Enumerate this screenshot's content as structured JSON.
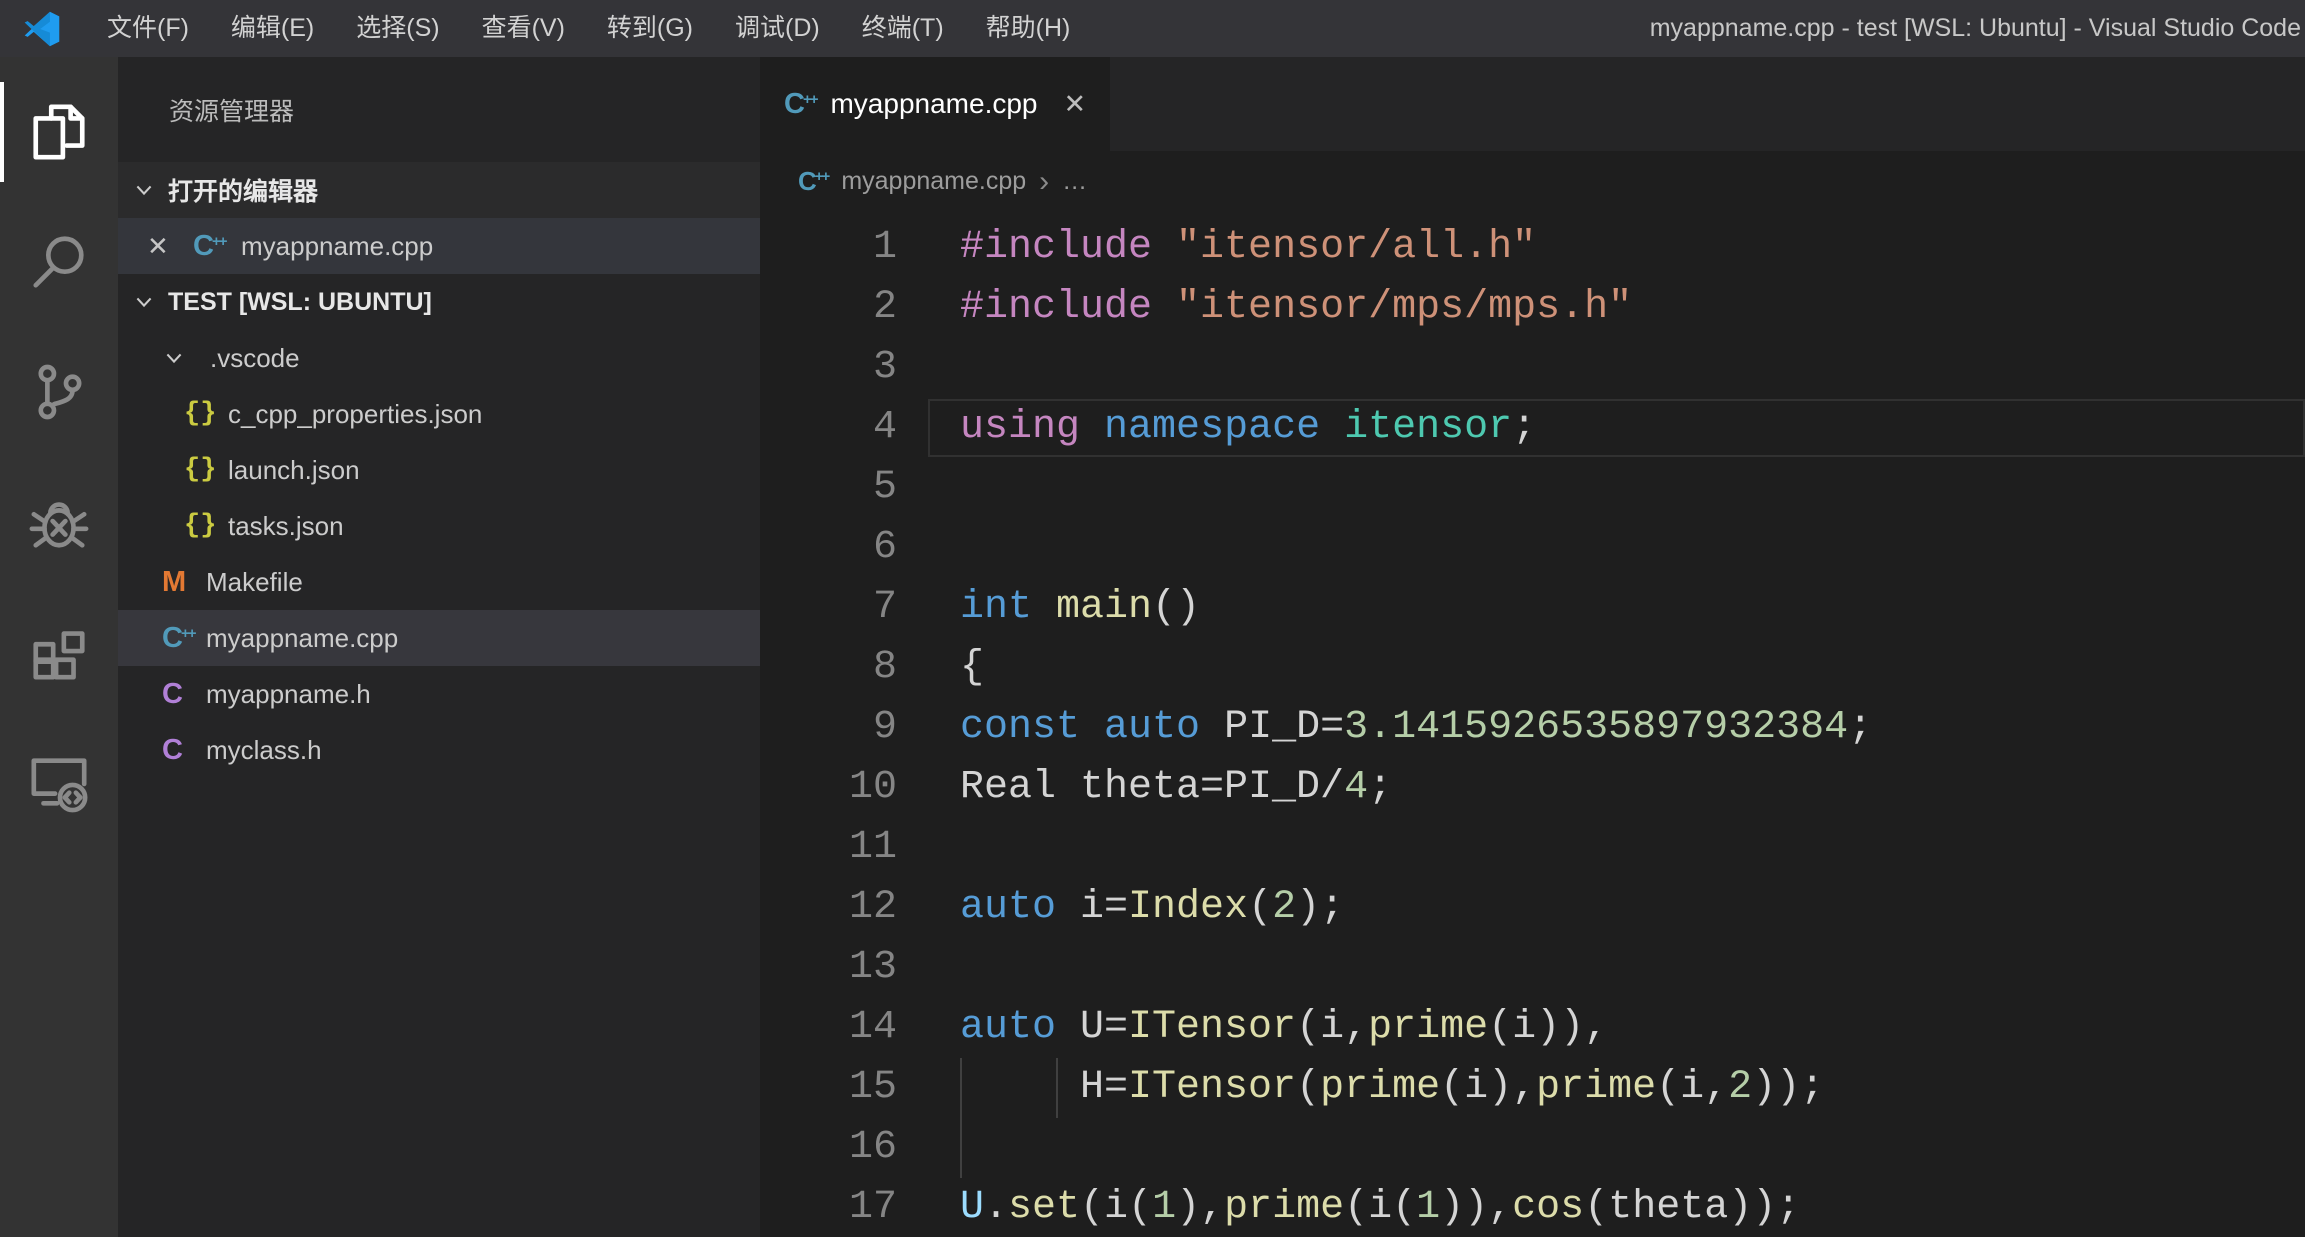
{
  "title_bar": {
    "menus": [
      "文件(F)",
      "编辑(E)",
      "选择(S)",
      "查看(V)",
      "转到(G)",
      "调试(D)",
      "终端(T)",
      "帮助(H)"
    ],
    "title": "myappname.cpp - test [WSL: Ubuntu] - Visual Studio Code"
  },
  "activity_bar": {
    "items": [
      {
        "name": "explorer",
        "active": true
      },
      {
        "name": "search",
        "active": false
      },
      {
        "name": "source-control",
        "active": false
      },
      {
        "name": "debug",
        "active": false
      },
      {
        "name": "extensions",
        "active": false
      },
      {
        "name": "remote-explorer",
        "active": false
      }
    ]
  },
  "sidebar": {
    "header": "资源管理器",
    "open_editors": {
      "label": "打开的编辑器",
      "items": [
        {
          "label": "myappname.cpp",
          "icon": "cpp"
        }
      ]
    },
    "workspace": {
      "label": "TEST [WSL: UBUNTU]",
      "tree": [
        {
          "label": ".vscode",
          "type": "folder",
          "level": 1,
          "expanded": true,
          "selected": false
        },
        {
          "label": "c_cpp_properties.json",
          "type": "json",
          "level": 2,
          "selected": false
        },
        {
          "label": "launch.json",
          "type": "json",
          "level": 2,
          "selected": false
        },
        {
          "label": "tasks.json",
          "type": "json",
          "level": 2,
          "selected": false
        },
        {
          "label": "Makefile",
          "type": "makefile",
          "level": 1,
          "selected": false
        },
        {
          "label": "myappname.cpp",
          "type": "cpp",
          "level": 1,
          "selected": true
        },
        {
          "label": "myappname.h",
          "type": "header",
          "level": 1,
          "selected": false
        },
        {
          "label": "myclass.h",
          "type": "header",
          "level": 1,
          "selected": false
        }
      ]
    }
  },
  "glyphs": {
    "close": "✕",
    "breadcrumb_sep": "›",
    "more": "…"
  },
  "editor": {
    "tab": {
      "label": "myappname.cpp",
      "icon": "cpp"
    },
    "breadcrumb": {
      "file": "myappname.cpp"
    },
    "colors": {
      "pp": "#C586C0",
      "str": "#CE9178",
      "kw": "#569CD6",
      "type": "#4EC9B0",
      "fn": "#DCDCAA",
      "num": "#B5CEA8",
      "var": "#9CDCFE",
      "def": "#D4D4D4"
    },
    "code": {
      "current_line": 4,
      "lines": [
        {
          "n": 1,
          "t": [
            [
              "pp",
              "#include"
            ],
            [
              "def",
              " "
            ],
            [
              "str",
              "\"itensor/all.h\""
            ]
          ]
        },
        {
          "n": 2,
          "t": [
            [
              "pp",
              "#include"
            ],
            [
              "def",
              " "
            ],
            [
              "str",
              "\"itensor/mps/mps.h\""
            ]
          ]
        },
        {
          "n": 3,
          "t": []
        },
        {
          "n": 4,
          "t": [
            [
              "pp",
              "using"
            ],
            [
              "def",
              " "
            ],
            [
              "kw",
              "namespace"
            ],
            [
              "def",
              " "
            ],
            [
              "type",
              "itensor"
            ],
            [
              "def",
              ";"
            ]
          ]
        },
        {
          "n": 5,
          "t": []
        },
        {
          "n": 6,
          "t": []
        },
        {
          "n": 7,
          "t": [
            [
              "kw",
              "int"
            ],
            [
              "def",
              " "
            ],
            [
              "fn",
              "main"
            ],
            [
              "def",
              "()"
            ]
          ]
        },
        {
          "n": 8,
          "t": [
            [
              "def",
              "{"
            ]
          ]
        },
        {
          "n": 9,
          "t": [
            [
              "kw",
              "const"
            ],
            [
              "def",
              " "
            ],
            [
              "kw",
              "auto"
            ],
            [
              "def",
              " PI_D="
            ],
            [
              "num",
              "3.1415926535897932384"
            ],
            [
              "def",
              ";"
            ]
          ]
        },
        {
          "n": 10,
          "t": [
            [
              "def",
              "Real theta=PI_D/"
            ],
            [
              "num",
              "4"
            ],
            [
              "def",
              ";"
            ]
          ]
        },
        {
          "n": 11,
          "t": []
        },
        {
          "n": 12,
          "t": [
            [
              "kw",
              "auto"
            ],
            [
              "def",
              " i="
            ],
            [
              "fn",
              "Index"
            ],
            [
              "def",
              "("
            ],
            [
              "num",
              "2"
            ],
            [
              "def",
              ");"
            ]
          ]
        },
        {
          "n": 13,
          "t": []
        },
        {
          "n": 14,
          "t": [
            [
              "kw",
              "auto"
            ],
            [
              "def",
              " U="
            ],
            [
              "fn",
              "ITensor"
            ],
            [
              "def",
              "(i,"
            ],
            [
              "fn",
              "prime"
            ],
            [
              "def",
              "(i)),"
            ]
          ]
        },
        {
          "n": 15,
          "t": [
            [
              "def",
              "     H="
            ],
            [
              "fn",
              "ITensor"
            ],
            [
              "def",
              "("
            ],
            [
              "fn",
              "prime"
            ],
            [
              "def",
              "(i),"
            ],
            [
              "fn",
              "prime"
            ],
            [
              "def",
              "(i,"
            ],
            [
              "num",
              "2"
            ],
            [
              "def",
              "));"
            ]
          ],
          "guides": [
            0,
            4
          ]
        },
        {
          "n": 16,
          "t": [],
          "guides": [
            0
          ]
        },
        {
          "n": 17,
          "t": [
            [
              "var",
              "U"
            ],
            [
              "def",
              "."
            ],
            [
              "fn",
              "set"
            ],
            [
              "def",
              "(i("
            ],
            [
              "num",
              "1"
            ],
            [
              "def",
              "),"
            ],
            [
              "fn",
              "prime"
            ],
            [
              "def",
              "(i("
            ],
            [
              "num",
              "1"
            ],
            [
              "def",
              ")),"
            ],
            [
              "fn",
              "cos"
            ],
            [
              "def",
              "(theta));"
            ]
          ]
        }
      ]
    }
  }
}
